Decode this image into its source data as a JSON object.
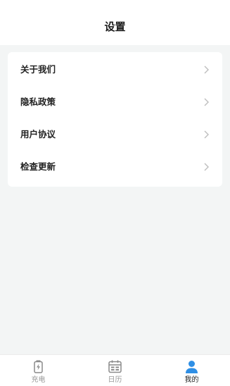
{
  "header": {
    "title": "设置"
  },
  "menu": {
    "items": [
      {
        "label": "关于我们"
      },
      {
        "label": "隐私政策"
      },
      {
        "label": "用户协议"
      },
      {
        "label": "检查更新"
      }
    ],
    "chevron_icon": "chevron-right-icon"
  },
  "tabbar": {
    "tabs": [
      {
        "label": "充电",
        "icon": "battery-charging-icon",
        "active": false
      },
      {
        "label": "日历",
        "icon": "calendar-icon",
        "active": false
      },
      {
        "label": "我的",
        "icon": "user-icon",
        "active": true
      }
    ]
  },
  "colors": {
    "background": "#f3f5f5",
    "card": "#ffffff",
    "active_icon": "#2f8fe5",
    "inactive": "#999999",
    "text": "#222222"
  }
}
